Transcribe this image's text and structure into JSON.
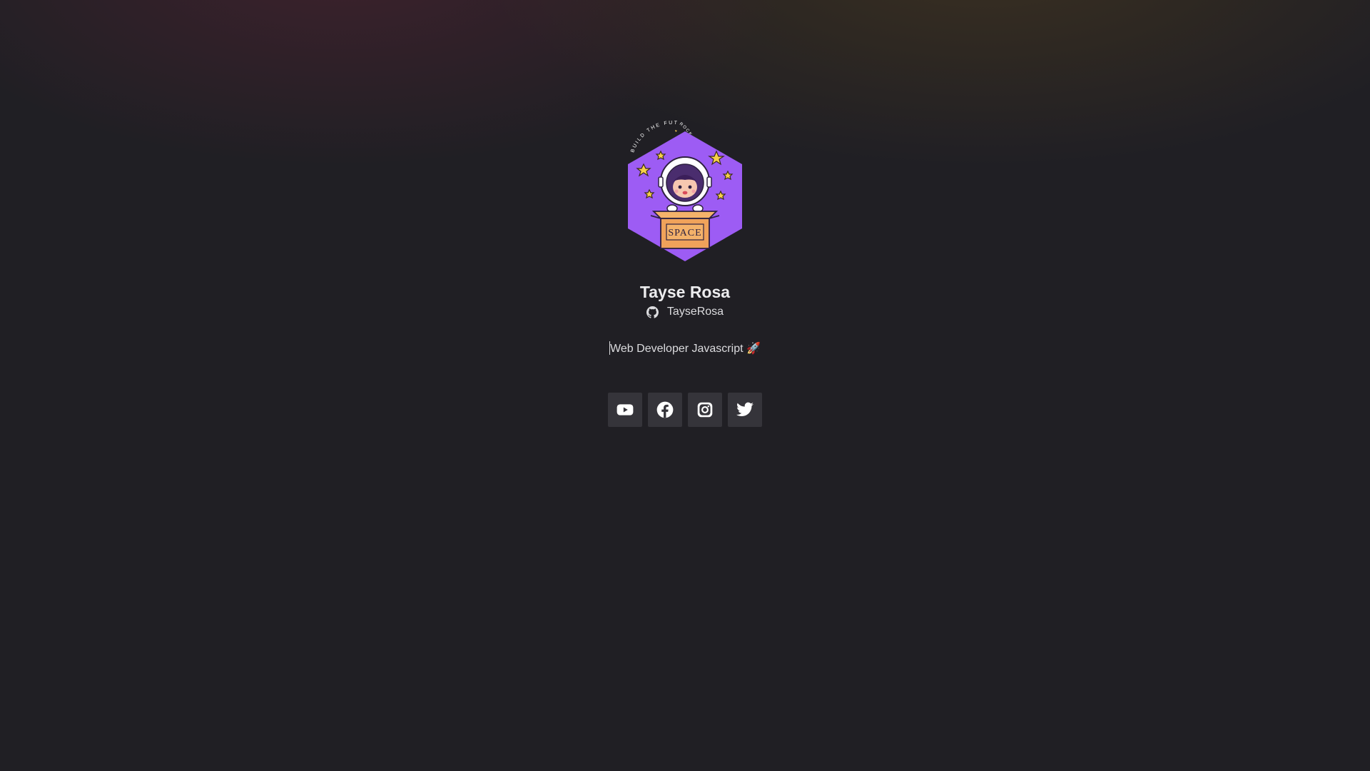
{
  "profile": {
    "name": "Tayse Rosa",
    "github_handle": "TayseRosa",
    "bio": "Web Developer Javascript 🚀",
    "avatar": {
      "arc_text": "BUILD THE FUTURE",
      "arc_text_right": "ROCK",
      "box_label": "SPACE",
      "hex_color": "#9d5cf4"
    }
  },
  "icons": {
    "github": "github-icon",
    "youtube": "youtube-icon",
    "facebook": "facebook-icon",
    "instagram": "instagram-icon",
    "twitter": "twitter-icon"
  },
  "colors": {
    "background": "#201f24",
    "button_bg": "#35343a",
    "text": "#e6e6e8"
  }
}
